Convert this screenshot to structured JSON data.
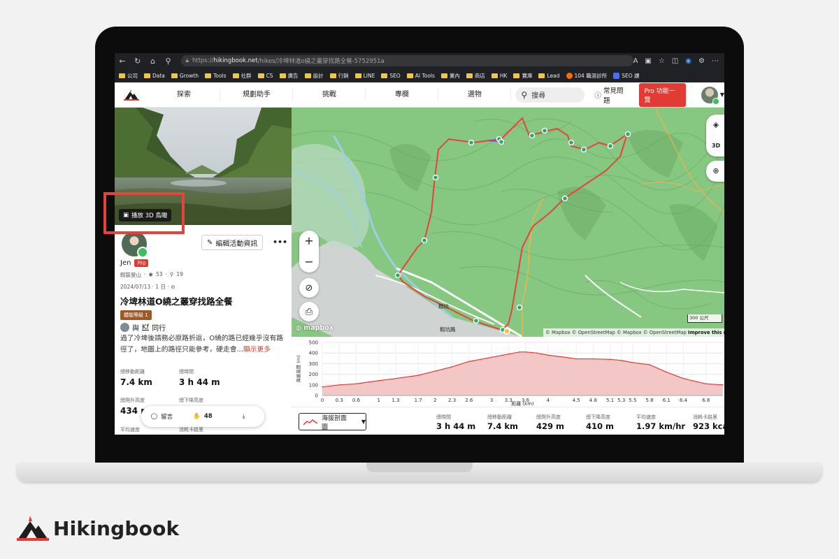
{
  "browser": {
    "url_prefix": "https://",
    "url_host": "hikingbook.net",
    "url_path": "/hikes/冷埤林道o繞之叢穿找路全餐-5752951a",
    "bookmarks": [
      "公司",
      "Data",
      "Growth",
      "Tools",
      "社群",
      "CS",
      "廣告",
      "設計",
      "行銷",
      "LINE",
      "SEO",
      "AI Tools",
      "業內",
      "商店",
      "HK",
      "寶庫",
      "Lead",
      "104 職涯診所",
      "SEO 課"
    ]
  },
  "header": {
    "nav": [
      "探索",
      "規劃助手",
      "挑戰",
      "專欄",
      "選物"
    ],
    "search_label": "搜尋",
    "faq_label": "常見問題",
    "pro_label": "Pro 功能一覽"
  },
  "activity": {
    "play_3d": "播放 3D 鳥瞰",
    "edit_button": "編輯活動資訊",
    "more": "•••",
    "author": "Jen",
    "pro_badge": "Pro",
    "meta_type": "輕裝登山",
    "meta_views": "53",
    "meta_likes": "19",
    "date": "2024/07/13 · 1 日 ·",
    "title": "冷埤林道O繞之叢穿找路全餐",
    "level": "體能等級 1",
    "companion_prefix": "與",
    "companion_name": "Kf",
    "companion_suffix": "同行",
    "description": "過了冷埤後請務必原路折返，O繞的路已經幾乎沒有路徑了，地圖上的路徑只能參考，硬走會...",
    "show_more": "顯示更多",
    "stats": {
      "distance_label": "總移動距離",
      "distance_value": "7.4 km",
      "time_label": "總時間",
      "time_value": "3 h 44 m",
      "ascent_label": "總爬升高度",
      "ascent_value": "434 m",
      "descent_label": "總下降高度",
      "pace_label": "平均速度",
      "cal_label": "消耗卡路里"
    },
    "actions": {
      "comment": "留言",
      "claps": "48"
    }
  },
  "map": {
    "logo": "mapbox",
    "scale": "300 公尺",
    "attribution": "© Mapbox © OpenStreetMap © Mapbox © OpenStreetMap",
    "improve": "Improve this m",
    "labels": {
      "village": "粗坑",
      "road": "粗坑路"
    }
  },
  "chart_data": {
    "type": "area",
    "title": "",
    "xlabel": "距離 (km)",
    "ylabel": "海拔高度 (m)",
    "xlim": [
      0,
      7.1
    ],
    "ylim": [
      0,
      500
    ],
    "x_ticks": [
      0,
      0.3,
      0.6,
      1,
      1.3,
      1.7,
      2,
      2.3,
      2.6,
      3,
      3.3,
      3.6,
      4,
      4.5,
      4.8,
      5.1,
      5.3,
      5.5,
      5.8,
      6.1,
      6.4,
      6.8
    ],
    "y_ticks": [
      0,
      100,
      200,
      300,
      400,
      500
    ],
    "grid": true,
    "x": [
      0,
      0.3,
      0.6,
      1.0,
      1.3,
      1.7,
      2.0,
      2.3,
      2.6,
      3.0,
      3.3,
      3.5,
      3.6,
      3.8,
      4.0,
      4.3,
      4.5,
      4.8,
      5.1,
      5.3,
      5.5,
      5.8,
      6.1,
      6.4,
      6.8,
      7.1
    ],
    "y": [
      80,
      100,
      110,
      140,
      160,
      190,
      230,
      270,
      320,
      360,
      390,
      410,
      410,
      400,
      380,
      360,
      345,
      345,
      340,
      330,
      310,
      290,
      220,
      160,
      110,
      100
    ],
    "fill_color": "#f4c7c7",
    "line_color": "#e23b33"
  },
  "summary": {
    "profile_button": "海拔剖面圖",
    "stats": [
      {
        "label": "總時間",
        "value": "3 h 44 m"
      },
      {
        "label": "總移動距離",
        "value": "7.4 km"
      },
      {
        "label": "總爬升高度",
        "value": "429 m"
      },
      {
        "label": "總下降高度",
        "value": "410 m"
      },
      {
        "label": "平均速度",
        "value": "1.97 km/hr"
      },
      {
        "label": "消耗卡路里",
        "value": "923 kca"
      }
    ]
  },
  "brand": {
    "name": "Hikingbook"
  },
  "colors": {
    "accent": "#e23b33",
    "route": "#e8423c",
    "waypoint": "#2ea86a",
    "forest": "#7fc47c"
  }
}
